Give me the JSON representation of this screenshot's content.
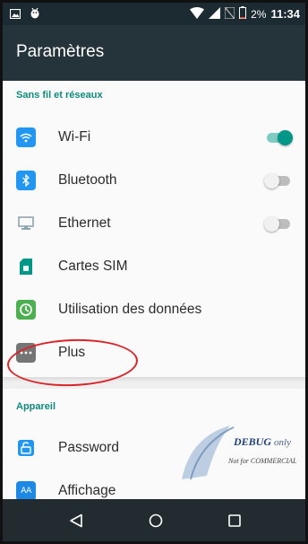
{
  "status_bar": {
    "battery_percent": "2%",
    "time": "11:34",
    "icons": [
      "image-notification-icon",
      "android-debug-icon",
      "wifi-icon",
      "signal-icon",
      "no-sim-icon",
      "battery-icon"
    ]
  },
  "app_bar": {
    "title": "Paramètres"
  },
  "sections": [
    {
      "header": "Sans fil et réseaux",
      "items": [
        {
          "label": "Wi-Fi",
          "icon": "wifi-icon",
          "toggle": "on",
          "icon_color": "#2196f3"
        },
        {
          "label": "Bluetooth",
          "icon": "bluetooth-icon",
          "toggle": "off",
          "icon_color": "#2196f3"
        },
        {
          "label": "Ethernet",
          "icon": "ethernet-icon",
          "toggle": "off",
          "icon_color": "#90a4ae"
        },
        {
          "label": "Cartes SIM",
          "icon": "sim-card-icon",
          "icon_color": "#009688"
        },
        {
          "label": "Utilisation des données",
          "icon": "data-usage-icon",
          "icon_color": "#4caf50"
        },
        {
          "label": "Plus",
          "icon": "more-icon",
          "icon_color": "#757575"
        }
      ]
    },
    {
      "header": "Appareil",
      "items": [
        {
          "label": "Password",
          "icon": "lock-icon",
          "icon_color": "#2196f3"
        },
        {
          "label": "Affichage",
          "icon": "display-icon",
          "icon_color": "#2196f3"
        }
      ]
    }
  ],
  "watermark": {
    "main": "DEBUG",
    "suffix": "only",
    "subtitle": "Not for COMMERCIAL"
  },
  "nav_bar": {
    "buttons": [
      "back-icon",
      "home-icon",
      "recents-icon"
    ]
  },
  "colors": {
    "status_bar": "#1c2a31",
    "app_bar": "#25343b",
    "accent": "#0f8a7d",
    "toggle_on": "#009688",
    "annotation": "#d9252a"
  }
}
